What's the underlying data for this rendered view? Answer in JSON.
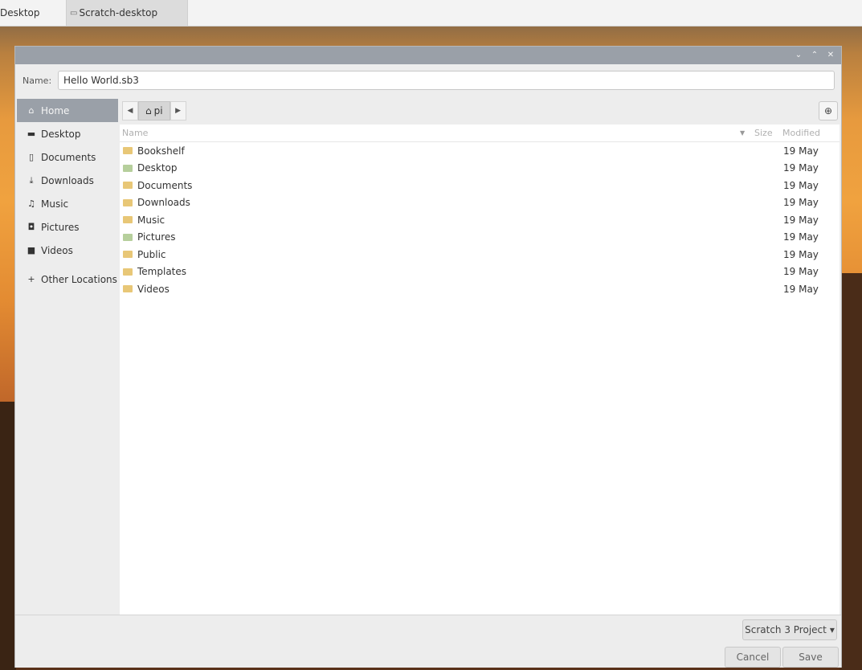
{
  "taskbar": {
    "items": [
      {
        "label": "Desktop"
      },
      {
        "label": "Scratch-desktop",
        "icon": "window-icon"
      }
    ]
  },
  "window_controls": {
    "minimize": "⌄",
    "maximize": "⌃",
    "close": "✕"
  },
  "dialog": {
    "name_label": "Name:",
    "name_value": "Hello World.sb3"
  },
  "sidebar": {
    "items": [
      {
        "label": "Home",
        "icon": "⌂"
      },
      {
        "label": "Desktop",
        "icon": "▬"
      },
      {
        "label": "Documents",
        "icon": "▯"
      },
      {
        "label": "Downloads",
        "icon": "⤓"
      },
      {
        "label": "Music",
        "icon": "♫"
      },
      {
        "label": "Pictures",
        "icon": "◘"
      },
      {
        "label": "Videos",
        "icon": "■"
      },
      {
        "label": "Other Locations",
        "icon": "+"
      }
    ]
  },
  "pathbar": {
    "back": "◀",
    "crumb_icon": "⌂",
    "crumb_label": "pi",
    "forward": "▶",
    "new_folder_icon": "⊕"
  },
  "file_list": {
    "columns": {
      "name": "Name",
      "size": "Size",
      "modified": "Modified"
    },
    "sort_indicator": "▼",
    "rows": [
      {
        "name": "Bookshelf",
        "modified": "19 May"
      },
      {
        "name": "Desktop",
        "modified": "19 May"
      },
      {
        "name": "Documents",
        "modified": "19 May"
      },
      {
        "name": "Downloads",
        "modified": "19 May"
      },
      {
        "name": "Music",
        "modified": "19 May"
      },
      {
        "name": "Pictures",
        "modified": "19 May"
      },
      {
        "name": "Public",
        "modified": "19 May"
      },
      {
        "name": "Templates",
        "modified": "19 May"
      },
      {
        "name": "Videos",
        "modified": "19 May"
      }
    ]
  },
  "footer": {
    "filter_label": "Scratch 3 Project",
    "filter_arrow": "▾",
    "cancel_label": "Cancel",
    "save_label": "Save"
  }
}
